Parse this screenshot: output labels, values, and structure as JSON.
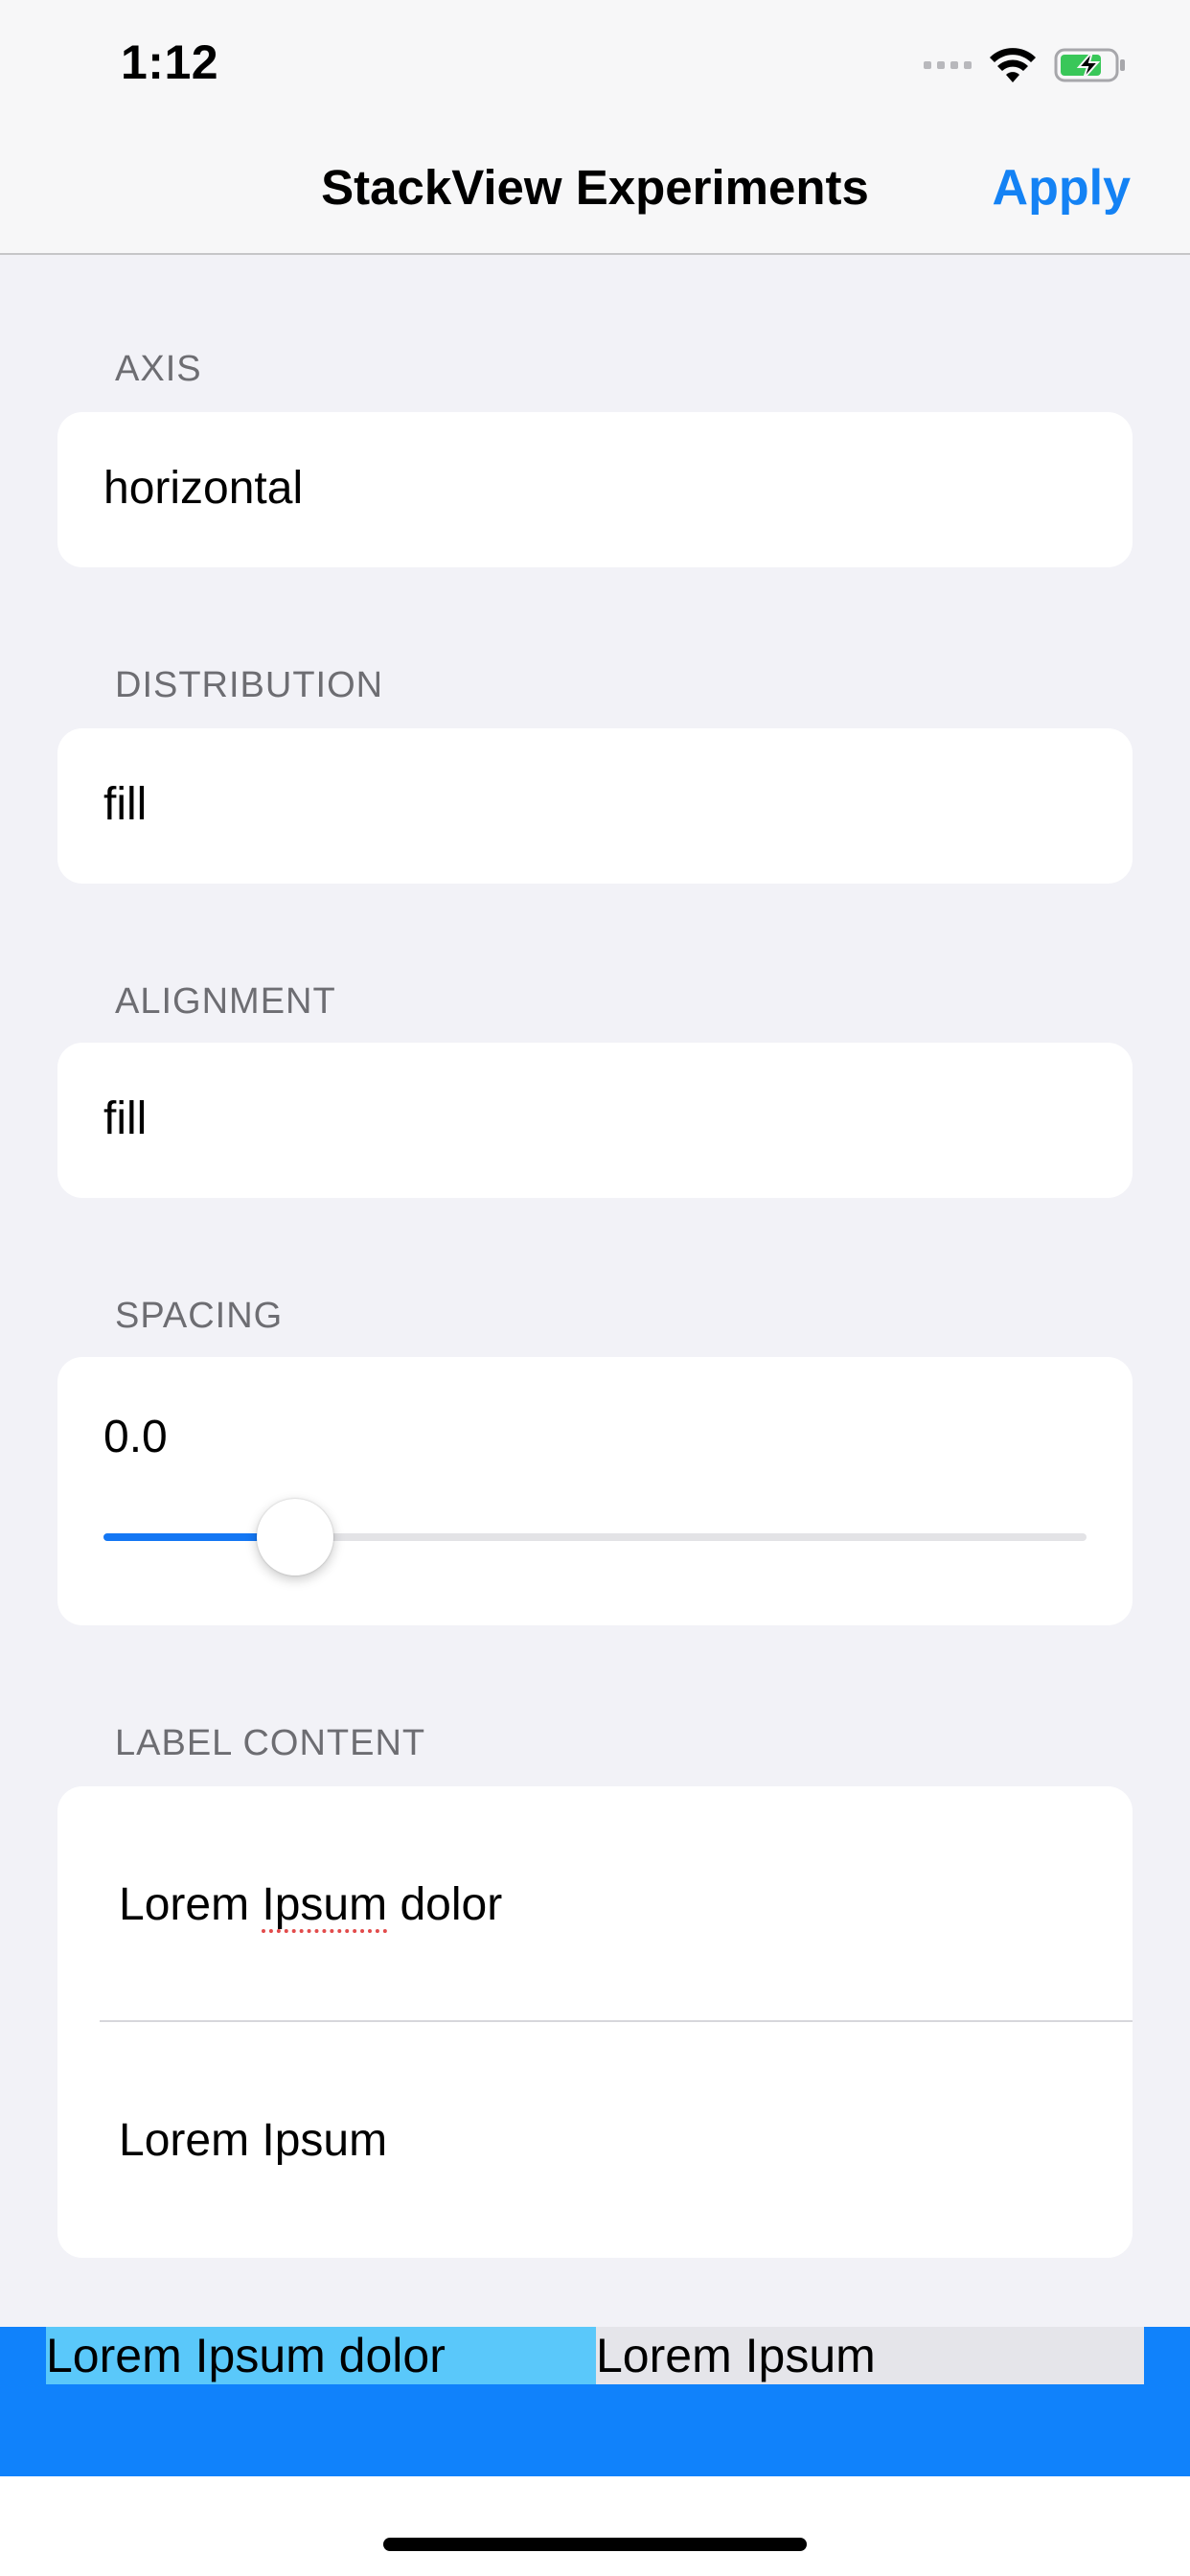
{
  "status_bar": {
    "time": "1:12",
    "icons": [
      "cellular-signal-icon",
      "wifi-icon",
      "battery-charging-icon"
    ]
  },
  "nav": {
    "title": "StackView Experiments",
    "apply_label": "Apply"
  },
  "sections": {
    "axis": {
      "header": "AXIS",
      "value": "horizontal"
    },
    "distribution": {
      "header": "DISTRIBUTION",
      "value": "fill"
    },
    "alignment": {
      "header": "ALIGNMENT",
      "value": "fill"
    },
    "spacing": {
      "header": "SPACING",
      "value": "0.0",
      "slider_fraction": 0.195
    },
    "label_content": {
      "header": "LABEL CONTENT",
      "items": [
        "Lorem Ipsum dolor",
        "Lorem Ipsum"
      ],
      "misspelled_word": "Ipsum"
    }
  },
  "preview": {
    "labels": [
      "Lorem Ipsum dolor",
      "Lorem Ipsum"
    ]
  },
  "colors": {
    "accent": "#1482f4",
    "preview_background": "#1082fb",
    "preview_label_1": "#5ac8fa",
    "preview_label_2": "#e5e5ea"
  }
}
